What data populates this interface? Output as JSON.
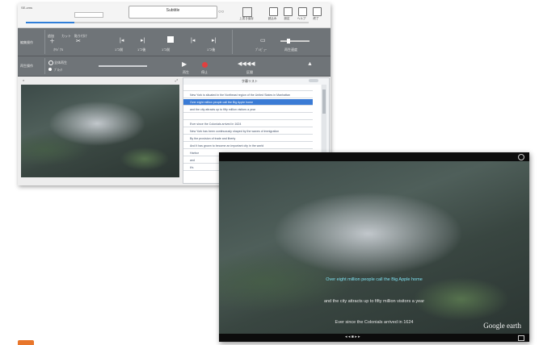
{
  "app": {
    "title": "Subtitle",
    "logo": "SE-cms",
    "toolbar_labels": [
      "上書き保存",
      "読込み",
      "設定",
      "ヘルプ",
      "終了"
    ]
  },
  "top_controls": {
    "label": "編集操作",
    "button_labels": [
      "追加",
      "カット",
      "貼り付け",
      "ｵﾘｼﾞﾅﾙ",
      "1つ前",
      "1つ後",
      "1つ前",
      "1つ後",
      "ﾌﾟﾚﾋﾞｭｰ",
      "再生速度"
    ]
  },
  "playback": {
    "label": "再生操作",
    "options": [
      "全体再生",
      "ﾌﾞﾛｯｸ"
    ],
    "button_labels": [
      "再生",
      "停止",
      "区間"
    ]
  },
  "subtitle_list": {
    "header": "字幕リスト",
    "rows": [
      "",
      "New York is situated in the Northeast region of the United States in Manhattan",
      "Over eight million people call the Big Apple home",
      "and the city attracts up to fifty million visitors a year",
      "",
      "Ever since the Colonials arrived in 1624",
      "New York has been continuously shaped by the waves of immigration",
      "By the provision of trade and liberty",
      "And it has grown to become an important city in the world",
      "Harbor",
      "and",
      "It's"
    ],
    "selected_index": 2
  },
  "preview": {
    "subtitles": [
      "Over eight million people call the Big Apple home",
      "and the city attracts up to fifty million visitors a year",
      "Ever since the Colonials arrived in 1624"
    ],
    "watermark": "Google earth"
  },
  "colors": {
    "band": "#6f7478",
    "accent": "#2f7ed8",
    "highlight_text": "#7ee0f0",
    "selected_row": "#3a7bd5",
    "marker": "#e8762b"
  }
}
